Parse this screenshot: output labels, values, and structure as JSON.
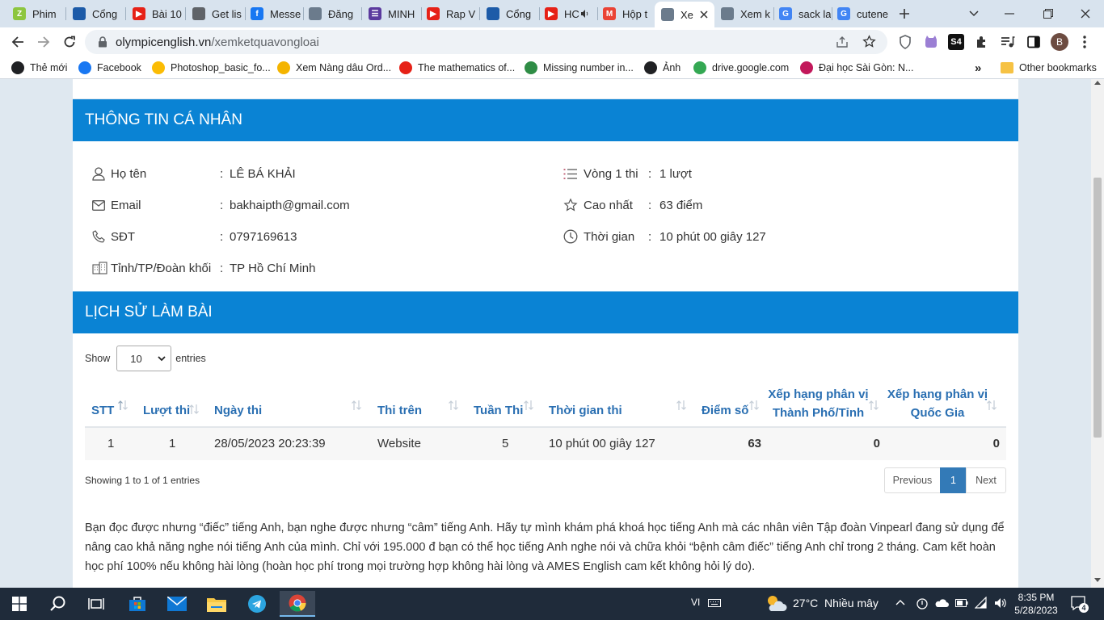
{
  "browser": {
    "tabs": [
      {
        "title": "Phim",
        "color": "#8dc63f",
        "glyph": "Z"
      },
      {
        "title": "Cổng",
        "color": "#1d5ba8",
        "glyph": ""
      },
      {
        "title": "Bài 10",
        "color": "#e62117",
        "glyph": "▶"
      },
      {
        "title": "Get lis",
        "color": "#5f6368",
        "glyph": ""
      },
      {
        "title": "Messe",
        "color": "#1877f2",
        "glyph": "f"
      },
      {
        "title": "Đăng",
        "color": "#6b7b8c",
        "glyph": ""
      },
      {
        "title": "MINH",
        "color": "#5b3a9e",
        "glyph": "☰"
      },
      {
        "title": "Rap V",
        "color": "#e62117",
        "glyph": "▶"
      },
      {
        "title": "Cổng",
        "color": "#1d5ba8",
        "glyph": ""
      },
      {
        "title": "HC",
        "color": "#e62117",
        "glyph": "▶"
      },
      {
        "title": "Hộp t",
        "color": "#ea4335",
        "glyph": "M"
      },
      {
        "title": "Xe",
        "color": "#6b7b8c",
        "glyph": ""
      },
      {
        "title": "Xem k",
        "color": "#6b7b8c",
        "glyph": ""
      },
      {
        "title": "sack la",
        "color": "#4285f4",
        "glyph": "G"
      },
      {
        "title": "cutene",
        "color": "#4285f4",
        "glyph": "G"
      }
    ],
    "url_domain": "olympicenglish.vn",
    "url_path": "/xemketquavongloai",
    "bookmarks": [
      {
        "label": "Thẻ mới",
        "color": "#202124"
      },
      {
        "label": "Facebook",
        "color": "#1877f2"
      },
      {
        "label": "Photoshop_basic_fo...",
        "color": "#fbbc04"
      },
      {
        "label": "Xem Nàng dâu Ord...",
        "color": "#f4b400"
      },
      {
        "label": "The mathematics of...",
        "color": "#e62117"
      },
      {
        "label": "Missing number in...",
        "color": "#2f8d46"
      },
      {
        "label": "Ảnh",
        "color": "#202124"
      },
      {
        "label": "drive.google.com",
        "color": "#34a853"
      },
      {
        "label": "Đại học Sài Gòn: N...",
        "color": "#c2185b"
      }
    ],
    "other_bookmarks": "Other bookmarks",
    "profile_initial": "B"
  },
  "profile": {
    "section_title": "THÔNG TIN CÁ NHÂN",
    "fields_left": [
      {
        "label": "Họ tên",
        "value": "LÊ BÁ KHẢI",
        "icon": "user-icon"
      },
      {
        "label": "Email",
        "value": "bakhaipth@gmail.com",
        "icon": "envelope-icon"
      },
      {
        "label": "SĐT",
        "value": "0797169613",
        "icon": "phone-icon"
      },
      {
        "label": "Tỉnh/TP/Đoàn khối",
        "value": "TP Hồ Chí Minh",
        "icon": "building-icon"
      }
    ],
    "fields_right": [
      {
        "label": "Vòng 1 thi",
        "value": "1 lượt",
        "icon": "list-icon"
      },
      {
        "label": "Cao nhất",
        "value": "63 điểm",
        "icon": "star-icon"
      },
      {
        "label": "Thời gian",
        "value": "10 phút 00 giây 127",
        "icon": "clock-icon"
      }
    ]
  },
  "history": {
    "section_title": "LỊCH SỬ LÀM BÀI",
    "show_label": "Show",
    "entries_label": "entries",
    "page_size": "10",
    "columns": [
      "STT",
      "Lượt thi",
      "Ngày thi",
      "Thi trên",
      "Tuần Thi",
      "Thời gian thi",
      "Điểm số",
      "Xếp hạng phân vị Thành Phố/Tỉnh",
      "Xếp hạng phân vị Quốc Gia"
    ],
    "col_rank_city_1": "Xếp hạng phân vị",
    "col_rank_city_2": "Thành Phố/Tỉnh",
    "col_rank_nat_1": "Xếp hạng phân vị",
    "col_rank_nat_2": "Quốc Gia",
    "rows": [
      {
        "stt": "1",
        "luot": "1",
        "ngay": "28/05/2023 20:23:39",
        "thi_tren": "Website",
        "tuan": "5",
        "thoi_gian": "10 phút 00 giây 127",
        "diem": "63",
        "rank_city": "0",
        "rank_nat": "0"
      }
    ],
    "info_text": "Showing 1 to 1 of 1 entries",
    "prev_label": "Previous",
    "current_page": "1",
    "next_label": "Next"
  },
  "promo_text": "Bạn đọc được nhưng “điếc” tiếng Anh, bạn nghe được nhưng “câm” tiếng Anh. Hãy tự mình khám phá khoá học tiếng Anh mà các nhân viên Tập đoàn Vinpearl đang sử dụng để nâng cao khả năng nghe nói tiếng Anh của mình. Chỉ với 195.000 đ bạn có thể học tiếng Anh nghe nói và chữa khỏi “bệnh câm điếc” tiếng Anh chỉ trong 2 tháng. Cam kết hoàn học phí 100% nếu không hài lòng (hoàn học phí trong mọi trường hợp không hài lòng và AMES English cam kết không hỏi lý do).",
  "taskbar": {
    "lang": "VI",
    "weather_temp": "27°C",
    "weather_desc": "Nhiều mây",
    "time": "8:35 PM",
    "date": "5/28/2023",
    "notif_count": "4"
  },
  "colors": {
    "accent": "#0a83d4",
    "header_text": "#2a6fb2",
    "page_bg": "#dfe8f0"
  }
}
